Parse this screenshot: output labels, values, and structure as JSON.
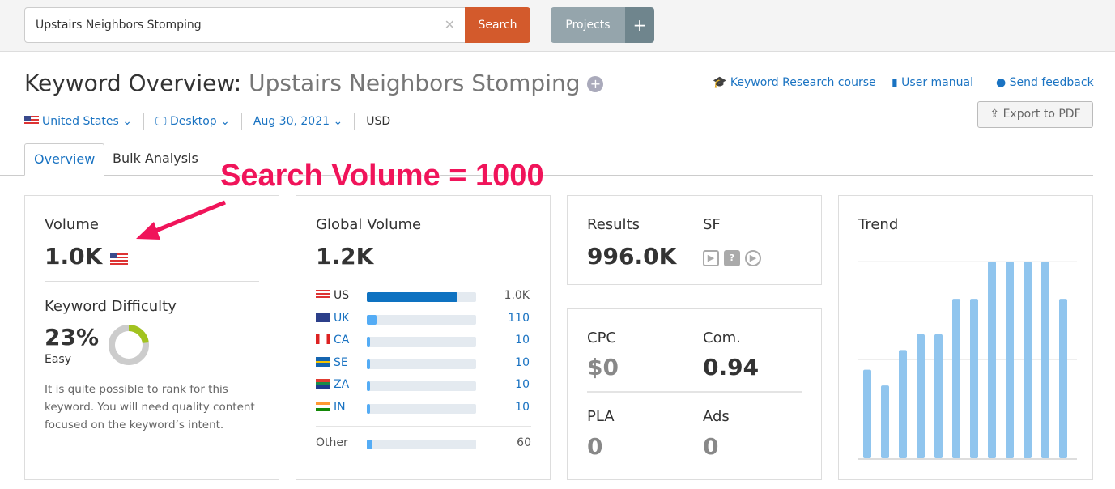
{
  "search": {
    "value": "Upstairs Neighbors Stomping",
    "button": "Search",
    "clear_icon": "close-icon"
  },
  "projects": {
    "label": "Projects",
    "add": "+"
  },
  "header": {
    "title": "Keyword Overview:",
    "keyword": "Upstairs Neighbors Stomping",
    "add_icon": "plus-circle-icon"
  },
  "links": {
    "course": "Keyword Research course",
    "manual": "User manual",
    "feedback": "Send feedback",
    "export": "Export to PDF"
  },
  "filters": {
    "country": "United States",
    "device": "Desktop",
    "date": "Aug 30, 2021",
    "currency": "USD"
  },
  "tabs": [
    {
      "label": "Overview",
      "active": true
    },
    {
      "label": "Bulk Analysis",
      "active": false
    }
  ],
  "annotation": "Search Volume = 1000",
  "volume": {
    "label": "Volume",
    "value": "1.0K"
  },
  "difficulty": {
    "label": "Keyword Difficulty",
    "value": "23%",
    "level": "Easy",
    "percent": 23,
    "color": "#a2c31f",
    "description": "It is quite possible to rank for this keyword. You will need quality content focused on the keyword’s intent."
  },
  "global": {
    "label": "Global Volume",
    "value": "1.2K",
    "countries": [
      {
        "code": "US",
        "value": "1.0K",
        "share": 0.83
      },
      {
        "code": "UK",
        "value": "110",
        "share": 0.09
      },
      {
        "code": "CA",
        "value": "10",
        "share": 0.01
      },
      {
        "code": "SE",
        "value": "10",
        "share": 0.01
      },
      {
        "code": "ZA",
        "value": "10",
        "share": 0.01
      },
      {
        "code": "IN",
        "value": "10",
        "share": 0.01
      }
    ],
    "other": {
      "label": "Other",
      "value": "60",
      "share": 0.05
    }
  },
  "results": {
    "label": "Results",
    "value": "996.0K",
    "sf_label": "SF",
    "sf_icons": [
      "video-icon",
      "faq-icon",
      "play-circle-icon"
    ]
  },
  "cpc": {
    "label": "CPC",
    "value": "$0"
  },
  "com": {
    "label": "Com.",
    "value": "0.94"
  },
  "pla": {
    "label": "PLA",
    "value": "0"
  },
  "ads": {
    "label": "Ads",
    "value": "0"
  },
  "chart_data": {
    "type": "bar",
    "title": "Trend",
    "values": [
      0.45,
      0.37,
      0.55,
      0.63,
      0.63,
      0.81,
      0.81,
      1,
      1,
      1,
      1,
      0.81
    ],
    "ylim": [
      0,
      1
    ],
    "grid": true,
    "color": "#90c5ee"
  }
}
